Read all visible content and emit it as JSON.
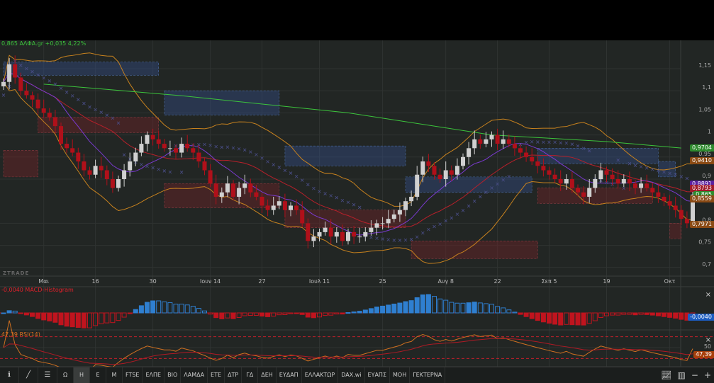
{
  "header": {
    "symbol_line": "0,865 ΑΛΦΑ.gr +0,035 4,22%",
    "watermark": "ZTRADE"
  },
  "macd": {
    "label": "-0,0040 MACD-Histogram",
    "value_tag": "-0,0040",
    "close_label": "×"
  },
  "rsi": {
    "label": "47,39 RSI(14)",
    "value_tag": "47,39",
    "level_label": "50",
    "close_label": "×"
  },
  "price_tags": [
    {
      "text": "0,9704",
      "color": "#2e8b2e",
      "price": 0.9704
    },
    {
      "text": "0,9410",
      "color": "#8a4a14",
      "price": 0.941
    },
    {
      "text": "0,8891",
      "color": "#5a1fa0",
      "price": 0.8891
    },
    {
      "text": "0,8793",
      "color": "#a01a2a",
      "price": 0.8793
    },
    {
      "text": "0,865",
      "color": "#2e8b2e",
      "price": 0.865
    },
    {
      "text": "0,8559",
      "color": "#8a4a14",
      "price": 0.8559
    },
    {
      "text": "0,7971",
      "color": "#8a4a14",
      "price": 0.7971
    }
  ],
  "toolbar": {
    "items": [
      "Ω",
      "Η",
      "Ε",
      "Μ",
      "FTSE",
      "ΕΛΠΕ",
      "ΒΙΟ",
      "ΛΑΜΔΑ",
      "ΕΤΕ",
      "ΔΤΡ",
      "ΓΔ",
      "ΔΕΗ",
      "ΕΥΔΑΠ",
      "ΕΛΛΑΚΤΩΡ",
      "DAX.wi",
      "ΕΥΑΠΣ",
      "ΜΟΗ",
      "ΓΕΚΤΕΡΝΑ"
    ],
    "active": "Η",
    "zoom_out": "−",
    "zoom_in": "+"
  },
  "colors": {
    "up": "#d0d0d0",
    "down": "#b0101a",
    "macd_pos": "#2f7fd0",
    "macd_neg": "#c0141e",
    "ma_long": "#3cc43c",
    "ma_mid": "#b8202a",
    "ma_fast": "#7a3ad0",
    "bands": "#c8821e"
  },
  "chart_data": {
    "type": "candlestick",
    "title": "0,865 ΑΛΦΑ.gr +0,035 4,22%",
    "ylim": [
      0.68,
      1.195
    ],
    "y_ticks": [
      {
        "v": 1.15,
        "t": "1,15"
      },
      {
        "v": 1.1,
        "t": "1,1"
      },
      {
        "v": 1.05,
        "t": "1,05"
      },
      {
        "v": 1.0,
        "t": "1"
      },
      {
        "v": 0.95,
        "t": "0,95"
      },
      {
        "v": 0.9,
        "t": "0,9"
      },
      {
        "v": 0.8,
        "t": "0,8"
      },
      {
        "v": 0.75,
        "t": "0,75"
      },
      {
        "v": 0.7,
        "t": "0,7"
      }
    ],
    "x_ticks": [
      {
        "i": 7,
        "t": "Μαι"
      },
      {
        "i": 16,
        "t": "16"
      },
      {
        "i": 26,
        "t": "30"
      },
      {
        "i": 36,
        "t": "Ιουν 14"
      },
      {
        "i": 45,
        "t": "27"
      },
      {
        "i": 55,
        "t": "Ιουλ 11"
      },
      {
        "i": 66,
        "t": "25"
      },
      {
        "i": 77,
        "t": "Αυγ 8"
      },
      {
        "i": 86,
        "t": "22"
      },
      {
        "i": 95,
        "t": "Σεπ 5"
      },
      {
        "i": 105,
        "t": "19"
      },
      {
        "i": 116,
        "t": "Οκτ"
      }
    ],
    "closes": [
      1.12,
      1.16,
      1.13,
      1.1,
      1.09,
      1.08,
      1.06,
      1.05,
      1.04,
      1.02,
      0.98,
      0.97,
      0.96,
      0.94,
      0.92,
      0.91,
      0.93,
      0.92,
      0.9,
      0.88,
      0.9,
      0.92,
      0.94,
      0.96,
      0.98,
      1.0,
      0.99,
      0.98,
      0.97,
      0.97,
      0.96,
      0.98,
      0.97,
      0.96,
      0.94,
      0.92,
      0.89,
      0.86,
      0.87,
      0.89,
      0.86,
      0.88,
      0.89,
      0.87,
      0.86,
      0.84,
      0.83,
      0.84,
      0.85,
      0.83,
      0.84,
      0.83,
      0.8,
      0.76,
      0.77,
      0.78,
      0.79,
      0.77,
      0.78,
      0.76,
      0.78,
      0.77,
      0.77,
      0.78,
      0.79,
      0.8,
      0.8,
      0.81,
      0.82,
      0.83,
      0.85,
      0.86,
      0.91,
      0.94,
      0.93,
      0.91,
      0.9,
      0.92,
      0.91,
      0.93,
      0.95,
      0.97,
      0.99,
      0.98,
      0.99,
      1.0,
      0.98,
      0.99,
      0.98,
      0.97,
      0.96,
      0.95,
      0.94,
      0.93,
      0.92,
      0.91,
      0.9,
      0.89,
      0.9,
      0.88,
      0.87,
      0.86,
      0.88,
      0.9,
      0.92,
      0.91,
      0.9,
      0.89,
      0.9,
      0.89,
      0.88,
      0.89,
      0.88,
      0.87,
      0.86,
      0.85,
      0.84,
      0.83,
      0.81,
      0.8,
      0.865
    ],
    "ma_long_points": [
      [
        7,
        1.115
      ],
      [
        30,
        1.09
      ],
      [
        60,
        1.05
      ],
      [
        85,
        1.0
      ],
      [
        105,
        0.985
      ],
      [
        118,
        0.9704
      ]
    ],
    "zones": [
      {
        "kind": "supply",
        "from": 0,
        "to": 27,
        "hi": 1.165,
        "lo": 1.135
      },
      {
        "kind": "supply",
        "from": 28,
        "to": 48,
        "hi": 1.1,
        "lo": 1.045
      },
      {
        "kind": "supply",
        "from": 49,
        "to": 70,
        "hi": 0.975,
        "lo": 0.93
      },
      {
        "kind": "supply",
        "from": 70,
        "to": 92,
        "hi": 0.905,
        "lo": 0.87
      },
      {
        "kind": "supply",
        "from": 93,
        "to": 114,
        "hi": 0.97,
        "lo": 0.935
      },
      {
        "kind": "supply",
        "from": 114,
        "to": 117,
        "hi": 0.94,
        "lo": 0.905
      },
      {
        "kind": "demand",
        "from": 0,
        "to": 6,
        "hi": 0.965,
        "lo": 0.905
      },
      {
        "kind": "demand",
        "from": 6,
        "to": 27,
        "hi": 1.04,
        "lo": 1.005
      },
      {
        "kind": "demand",
        "from": 28,
        "to": 48,
        "hi": 0.89,
        "lo": 0.835
      },
      {
        "kind": "demand",
        "from": 49,
        "to": 70,
        "hi": 0.83,
        "lo": 0.79
      },
      {
        "kind": "demand",
        "from": 71,
        "to": 93,
        "hi": 0.76,
        "lo": 0.72
      },
      {
        "kind": "demand",
        "from": 93,
        "to": 113,
        "hi": 0.88,
        "lo": 0.845
      },
      {
        "kind": "demand",
        "from": 116,
        "to": 118,
        "hi": 0.8,
        "lo": 0.765
      }
    ]
  }
}
